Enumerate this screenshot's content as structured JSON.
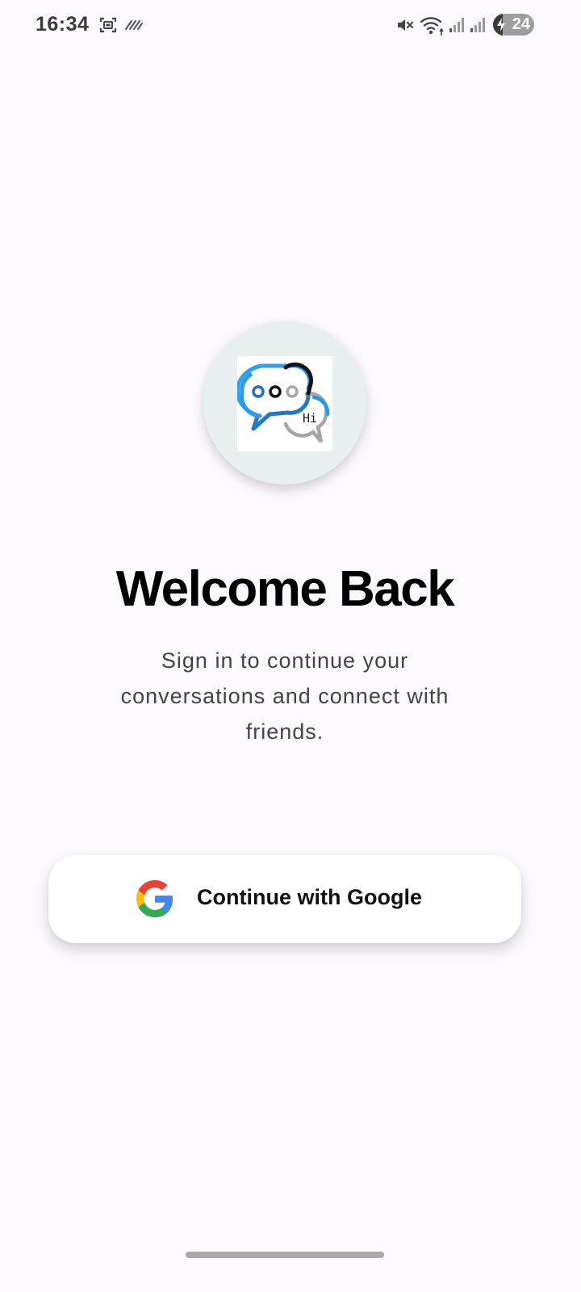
{
  "status_bar": {
    "time": "16:34",
    "battery_level": "24",
    "battery_fraction": 0.24,
    "icons": [
      "screenshot-icon",
      "nfc-icon",
      "mute-icon",
      "wifi-icon",
      "signal-icon",
      "signal-icon",
      "charging-icon"
    ]
  },
  "logo": {
    "bubble_text": "Hi",
    "icon": "chat-bubbles-logo"
  },
  "welcome": {
    "title": "Welcome Back",
    "subtitle": "Sign in to continue your conversations and connect with friends."
  },
  "google_button": {
    "label": "Continue with Google",
    "icon": "google-g-icon"
  },
  "colors": {
    "background": "#fbf9fd",
    "logo_circle": "#e9eeee",
    "bubble_blue": "#2196f3",
    "google_blue": "#4285F4",
    "google_red": "#EA4335",
    "google_yellow": "#FBBC05",
    "google_green": "#34A853"
  }
}
